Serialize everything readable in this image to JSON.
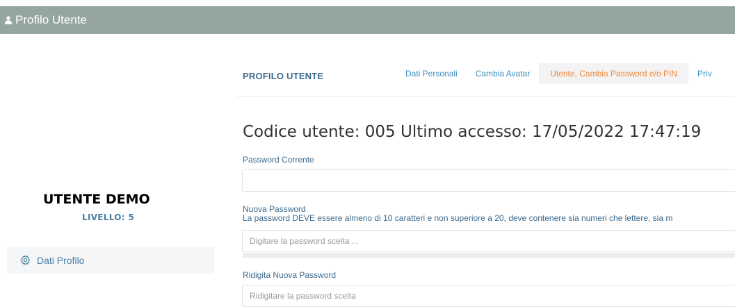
{
  "header": {
    "title": "Profilo Utente",
    "icon": "user-icon"
  },
  "sidebar": {
    "user_name": "UTENTE DEMO",
    "level": "LIVELLO: 5",
    "items": [
      {
        "label": "Dati Profilo",
        "icon": "gear-icon"
      }
    ]
  },
  "panel": {
    "title": "PROFILO UTENTE",
    "tabs": [
      {
        "label": "Dati Personali",
        "active": false
      },
      {
        "label": "Cambia Avatar",
        "active": false
      },
      {
        "label": "Utente, Cambia Password e/o PIN",
        "active": true
      },
      {
        "label": "Priv",
        "active": false
      }
    ]
  },
  "form": {
    "heading": "Codice utente:   005 Ultimo accesso: 17/05/2022 17:47:19",
    "current_password": {
      "label": "Password Corrente",
      "value": "",
      "placeholder": ""
    },
    "new_password": {
      "label": "Nuova Password",
      "help": "La password DEVE essere almeno di 10 caratteri e non superiore a 20, deve contenere sia numeri che lettere, sia m",
      "placeholder": "Digitare la password scelta ..."
    },
    "repeat_password": {
      "label": "Ridigita Nuova Password",
      "placeholder": "Ridigitare la password scelta"
    }
  },
  "colors": {
    "header_bg": "#95a5a0",
    "link": "#3c8dbc",
    "active_tab": "#f0883a",
    "label": "#3e6b8e"
  }
}
